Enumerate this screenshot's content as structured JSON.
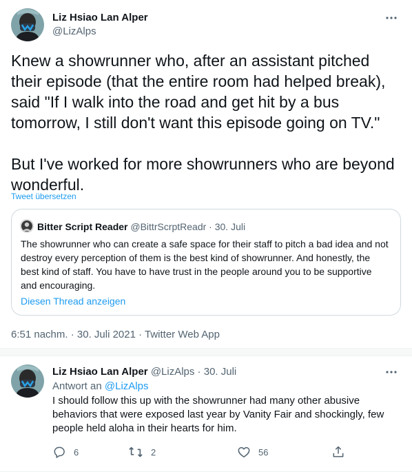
{
  "main_tweet": {
    "author": {
      "display_name": "Liz Hsiao Lan Alper",
      "handle": "@LizAlps",
      "avatar_icon": "masked-person-avatar"
    },
    "more_icon": "more-dots-icon",
    "text": "Knew a showrunner who, after an assistant pitched their episode (that the entire room had helped break), said \"If I walk into the road and get hit by a bus tomorrow, I still don't want this episode going on TV.\"\n\nBut I've worked for more showrunners who are beyond wonderful.",
    "translate_label": "Tweet übersetzen",
    "quote": {
      "avatar_icon": "person-avatar",
      "display_name": "Bitter Script Reader",
      "handle_date": "@BittrScrptReadr · 30. Juli",
      "text": "The showrunner who can create a safe space for their staff to pitch a bad idea and not destroy every perception of them is the best kind of showrunner. And honestly, the best kind of staff. You have to have trust in the people around you to be supportive and encouraging.",
      "thread_link": "Diesen Thread anzeigen"
    },
    "timestamp": "6:51 nachm. · 30. Juli 2021 · Twitter Web App"
  },
  "reply_tweet": {
    "author": {
      "display_name": "Liz Hsiao Lan Alper",
      "handle_date": "@LizAlps · 30. Juli",
      "avatar_icon": "masked-person-avatar"
    },
    "reply_prefix": "Antwort an ",
    "reply_mention": "@LizAlps",
    "text": "I should follow this up with the showrunner had many other abusive behaviors that were exposed last year by Vanity Fair and shockingly, few people held aloha in their hearts for him.",
    "actions": {
      "reply_count": "6",
      "retweet_count": "2",
      "like_count": "56"
    }
  },
  "colors": {
    "accent": "#1d9bf0",
    "secondary_text": "#536471",
    "border": "#cfd9de"
  }
}
